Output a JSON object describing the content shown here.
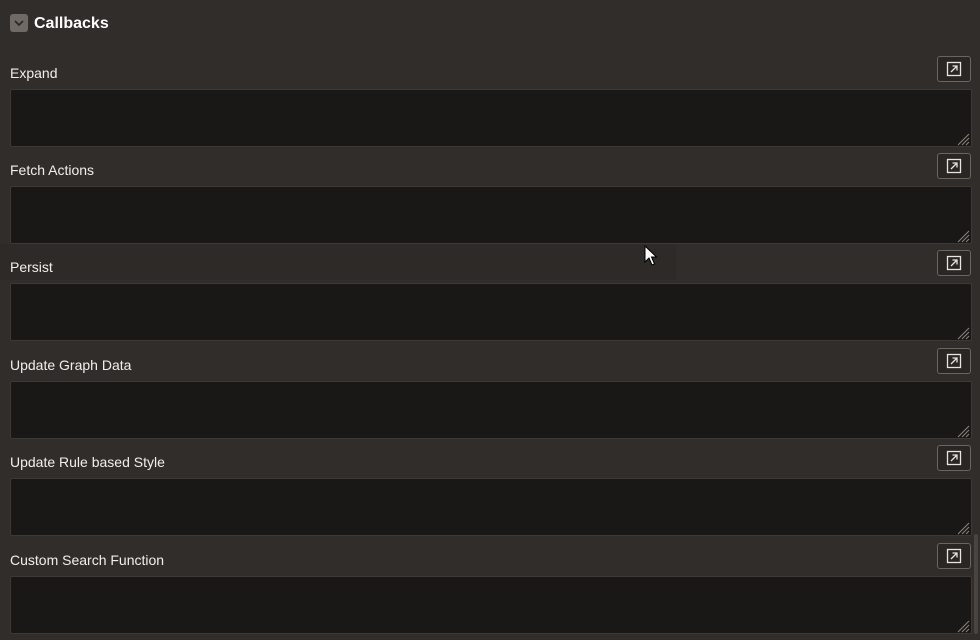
{
  "section": {
    "title": "Callbacks",
    "toggle_icon": "chevron-down-icon"
  },
  "fields": [
    {
      "label": "Expand",
      "value": "",
      "button_icon": "open-in-editor-icon"
    },
    {
      "label": "Fetch Actions",
      "value": "",
      "button_icon": "open-in-editor-icon"
    },
    {
      "label": "Persist",
      "value": "",
      "button_icon": "open-in-editor-icon"
    },
    {
      "label": "Update Graph Data",
      "value": "",
      "button_icon": "open-in-editor-icon"
    },
    {
      "label": "Update Rule based Style",
      "value": "",
      "button_icon": "open-in-editor-icon"
    },
    {
      "label": "Custom Search Function",
      "value": "",
      "button_icon": "open-in-editor-icon"
    }
  ],
  "colors": {
    "background": "#312d2a",
    "editor_background": "#1a1816",
    "text": "#f1efed"
  }
}
